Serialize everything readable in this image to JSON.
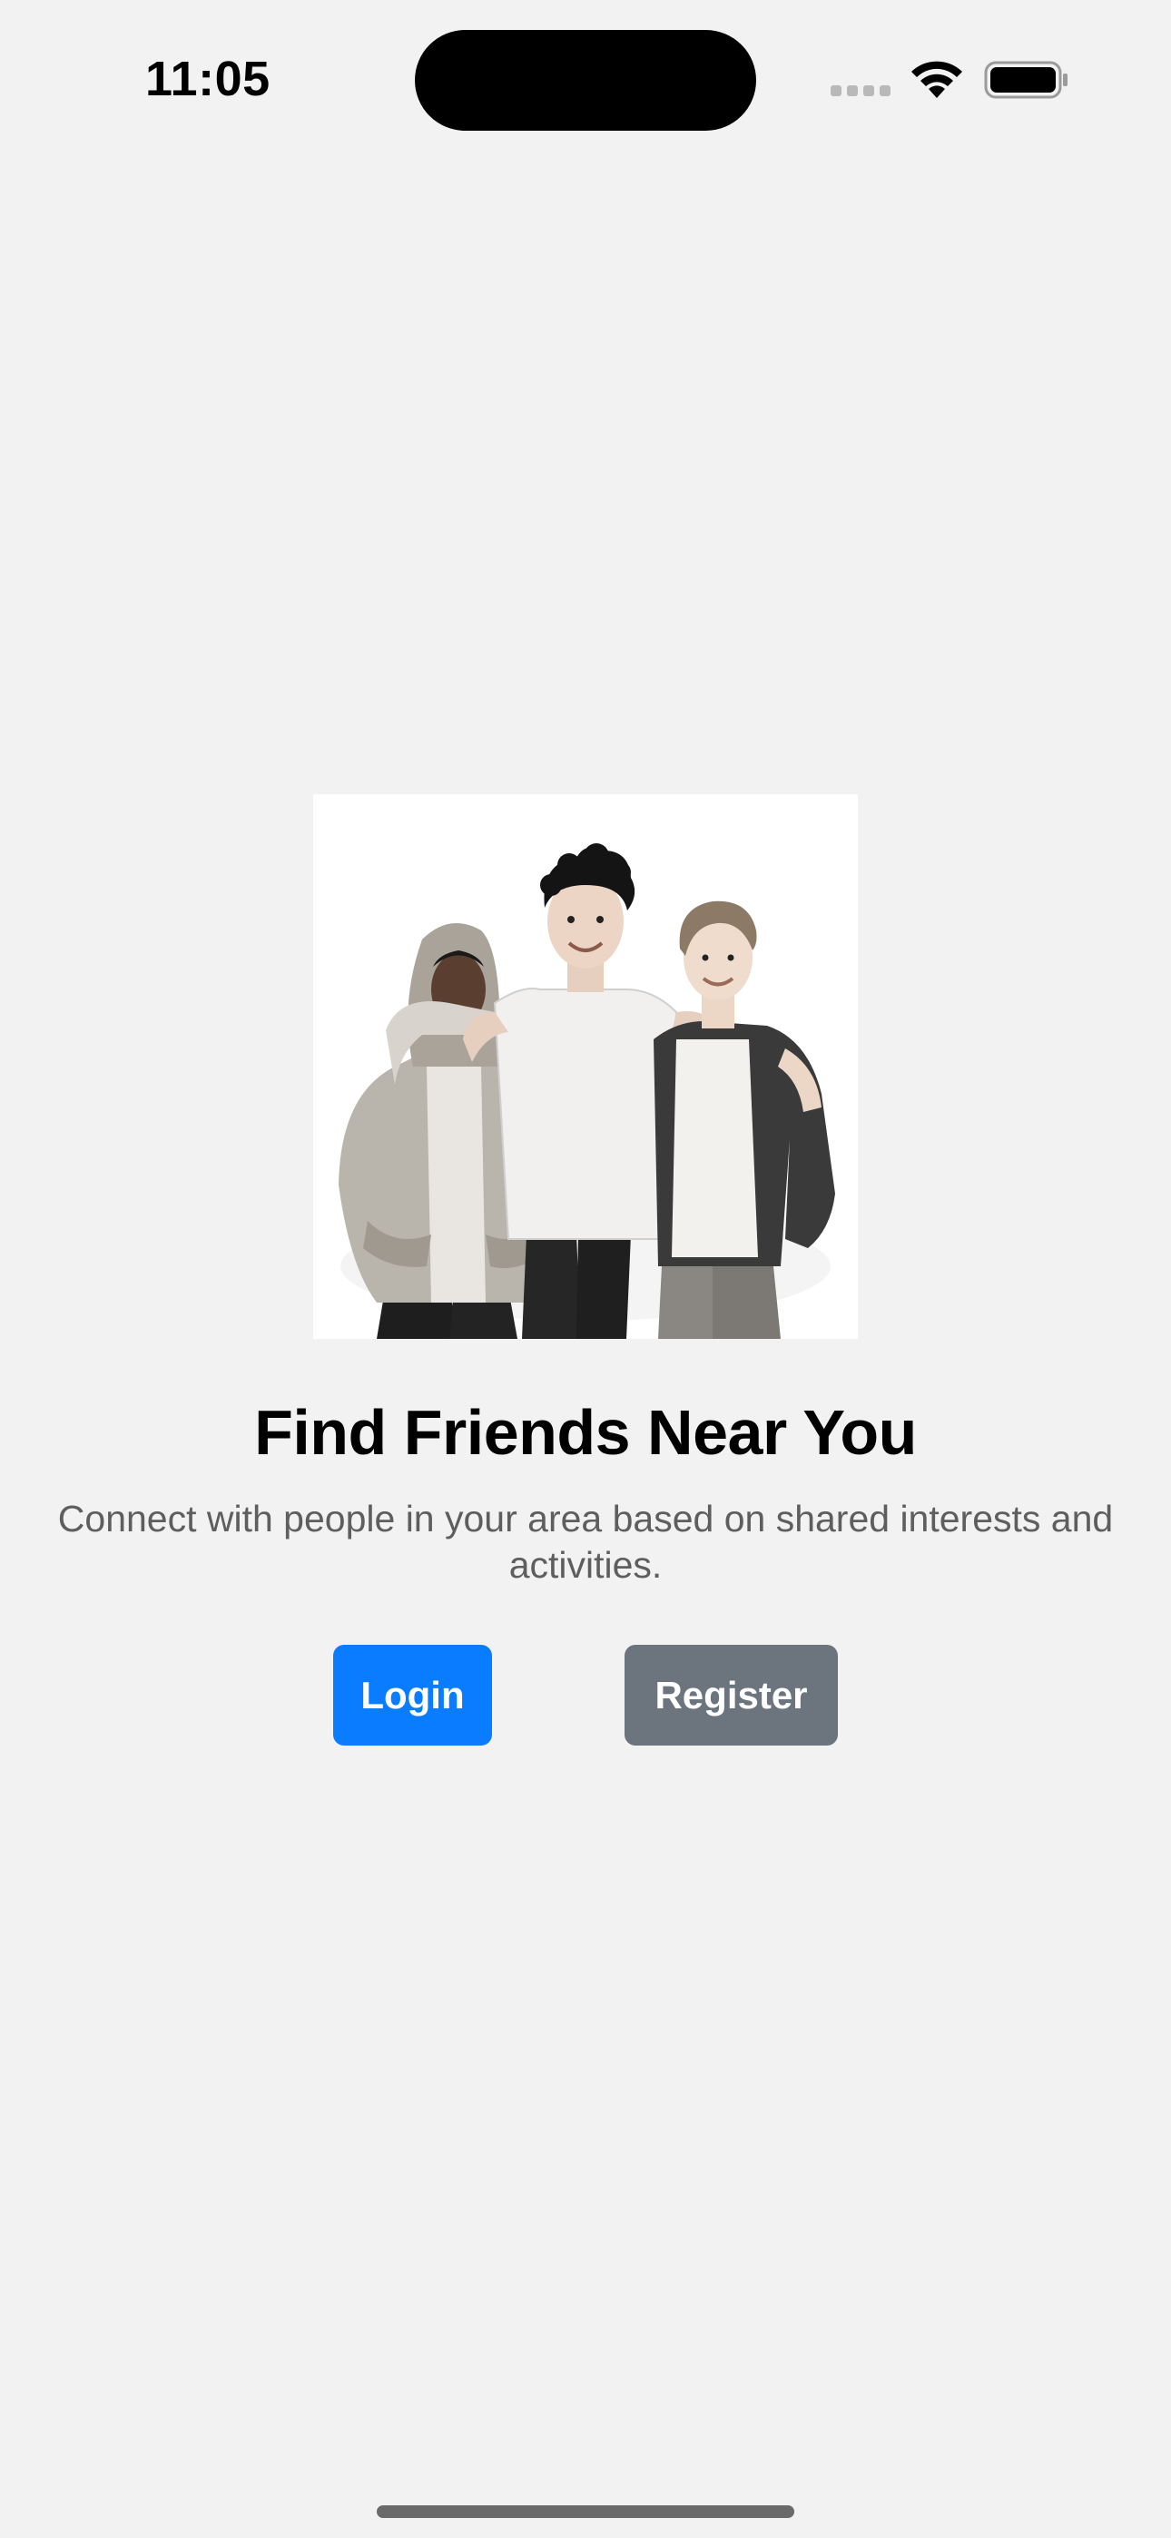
{
  "status_bar": {
    "time": "11:05",
    "icons": [
      "signal-dots-icon",
      "wifi-icon",
      "battery-icon"
    ]
  },
  "hero": {
    "image_description_icon": "three-friends-illustration"
  },
  "main": {
    "title": "Find Friends Near You",
    "subtitle": "Connect with people in your area based on shared interests and activities."
  },
  "buttons": {
    "login_label": "Login",
    "register_label": "Register"
  },
  "colors": {
    "background": "#f2f2f2",
    "login_button": "#0a7cff",
    "register_button": "#6c757d",
    "subtitle_text": "#5e5e5e"
  }
}
